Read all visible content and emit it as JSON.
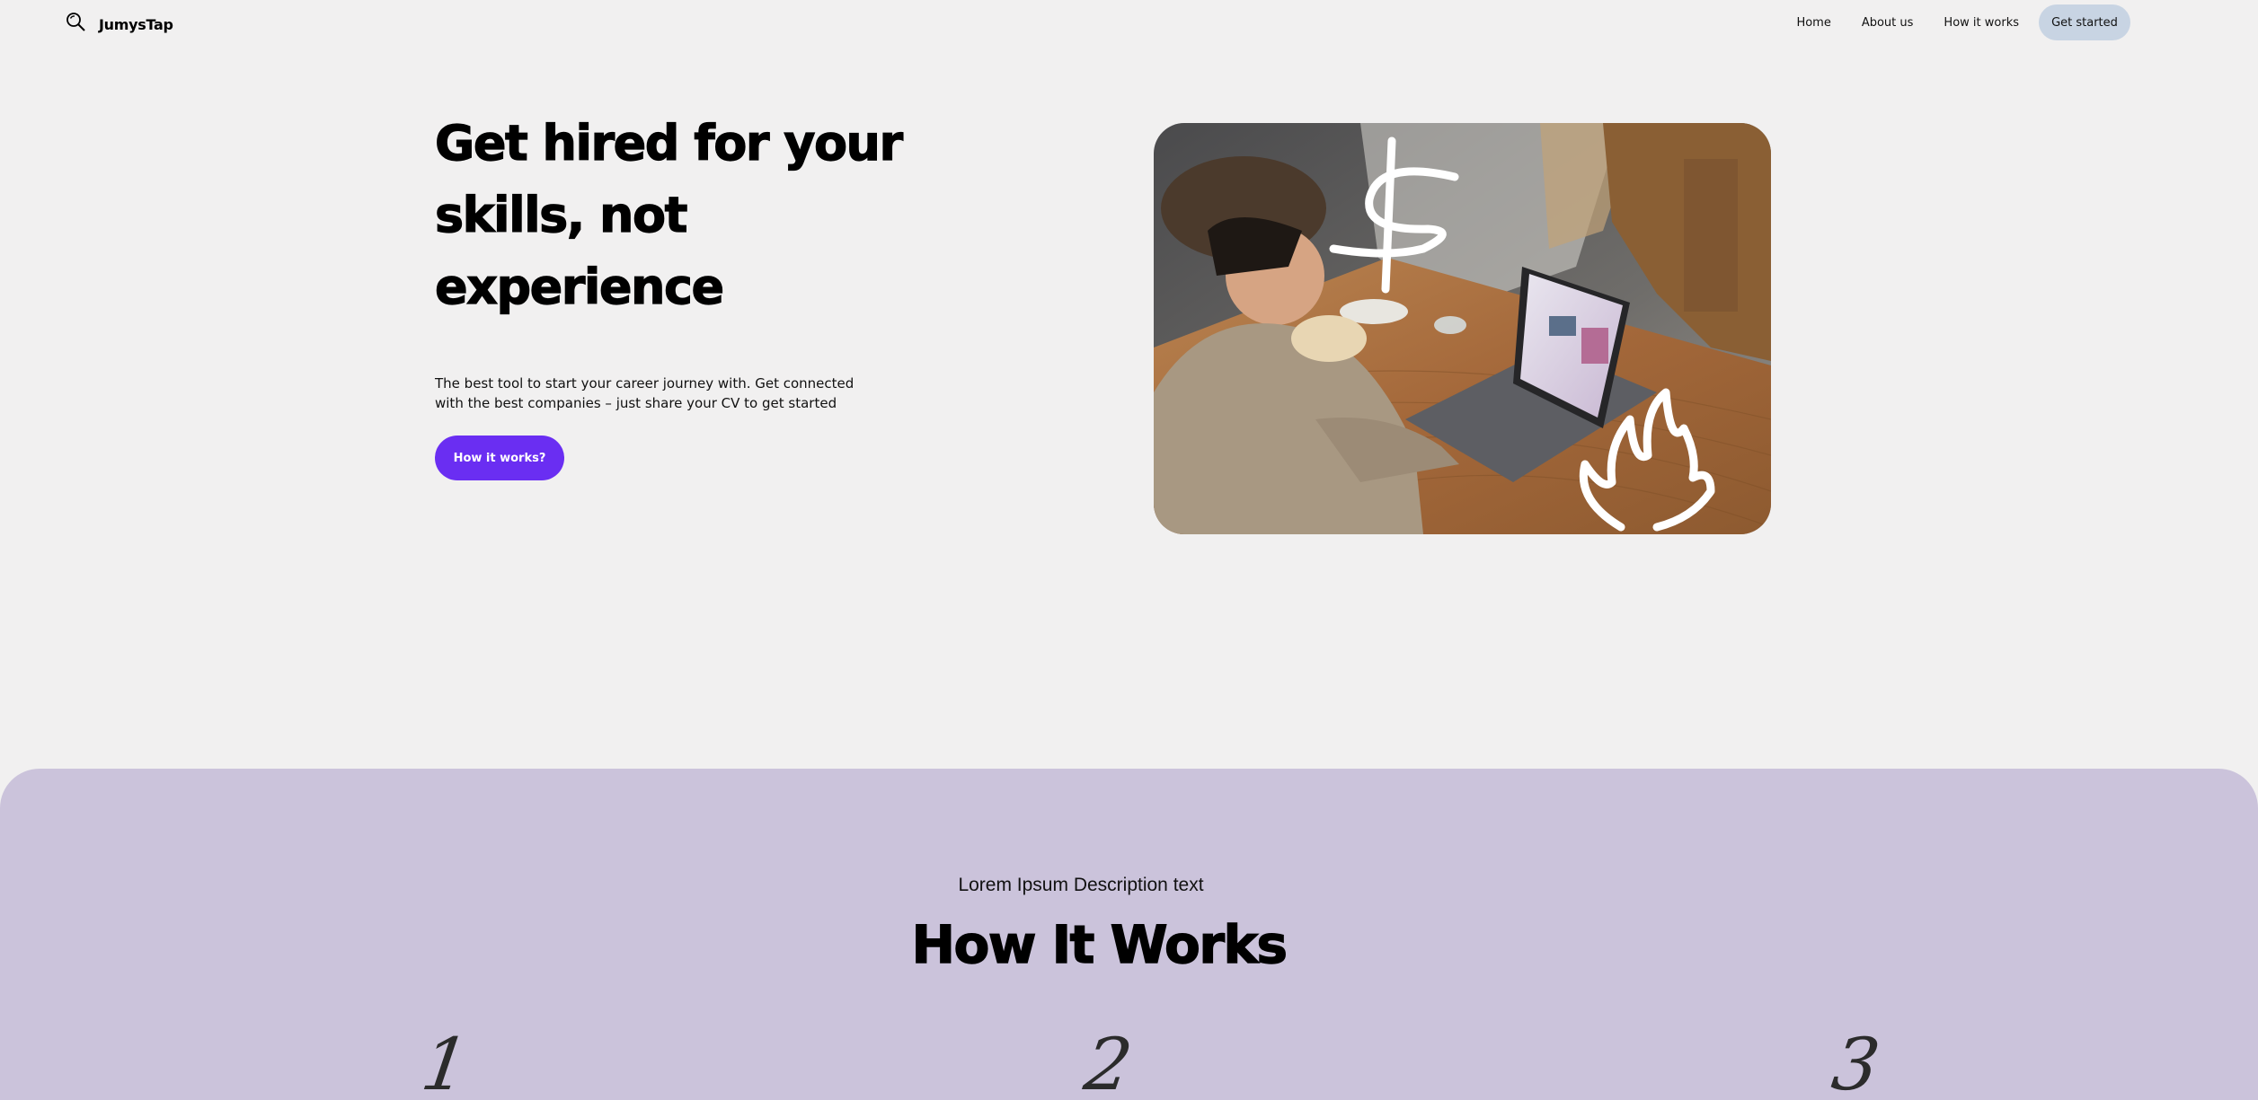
{
  "nav": {
    "brand_name": "JumysTap",
    "brand_icon": "search-icon",
    "links": [
      {
        "label": "Home"
      },
      {
        "label": "About us"
      },
      {
        "label": "How it works"
      }
    ],
    "cta_label": "Get started",
    "cta_color": "#c8d4e3"
  },
  "hero": {
    "title": "Get hired for your skills, not experience",
    "subtitle": "The best tool to start your career journey with. Get connected with the best companies – just share your CV to get started",
    "button_label": "How it works?",
    "button_color": "#6a2ef2"
  },
  "how_it_works": {
    "eyebrow": "Lorem Ipsum Description text",
    "title": "How It Works",
    "background": "#cbc3db",
    "steps": [
      {
        "number": "1"
      },
      {
        "number": "2"
      },
      {
        "number": "3"
      }
    ]
  }
}
